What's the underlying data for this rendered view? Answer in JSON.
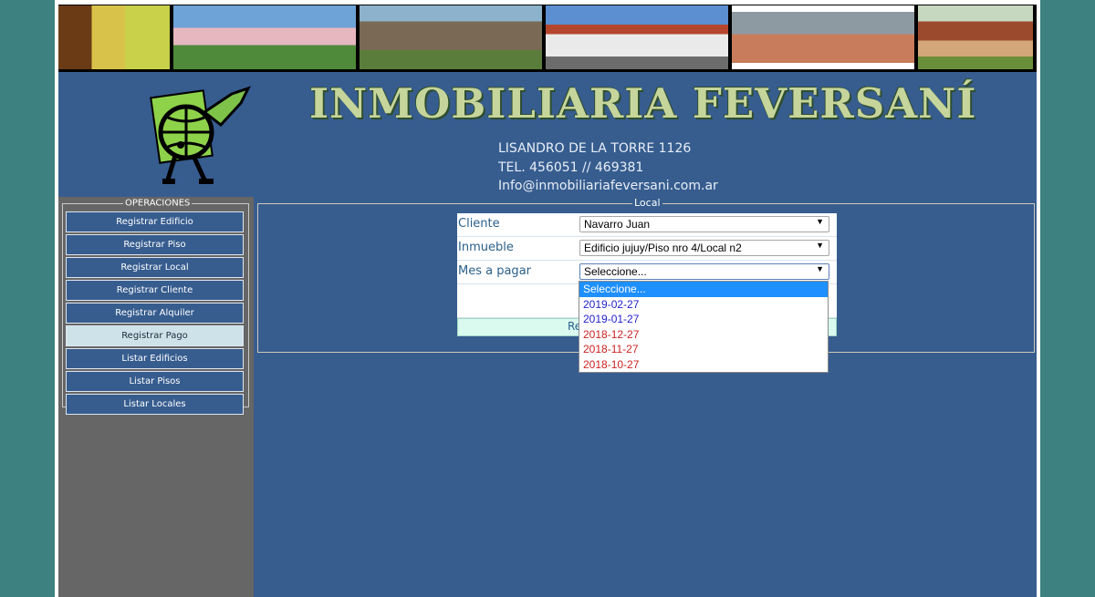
{
  "header": {
    "title": "INMOBILIARIA FEVERSANÍ",
    "address": "LISANDRO DE LA TORRE 1126",
    "phone": "TEL. 456051 // 469381",
    "email": "Info@inmobiliariafeversani.com.ar"
  },
  "sidebar": {
    "legend": "OPERACIONES",
    "items": [
      {
        "label": "Registrar Edificio"
      },
      {
        "label": "Registrar Piso"
      },
      {
        "label": "Registrar Local"
      },
      {
        "label": "Registrar Cliente"
      },
      {
        "label": "Registrar Alquiler"
      },
      {
        "label": "Registrar Pago",
        "active": true
      },
      {
        "label": "Listar Edificios"
      },
      {
        "label": "Listar Pisos"
      },
      {
        "label": "Listar Locales"
      }
    ]
  },
  "form": {
    "legend": "Local",
    "fields": [
      {
        "label": "Cliente",
        "value": "Navarro Juan"
      },
      {
        "label": "Inmueble",
        "value": "Edificio jujuy/Piso nro 4/Local n2"
      },
      {
        "label": "Mes a pagar",
        "value": "Seleccione..."
      }
    ],
    "submit_label": "Re"
  },
  "dropdown": {
    "options": [
      {
        "label": "Seleccione...",
        "state": "selected"
      },
      {
        "label": "2019-02-27",
        "color": "blue"
      },
      {
        "label": "2019-01-27",
        "color": "blue"
      },
      {
        "label": "2018-12-27",
        "color": "red"
      },
      {
        "label": "2018-11-27",
        "color": "red"
      },
      {
        "label": "2018-10-27",
        "color": "red"
      }
    ]
  }
}
